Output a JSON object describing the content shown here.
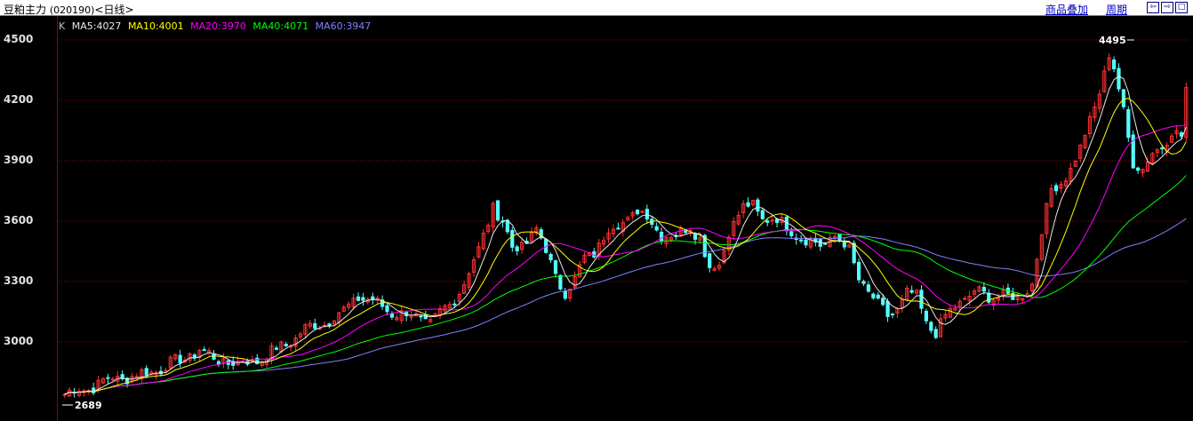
{
  "window": {
    "title_name": "豆粕主力",
    "title_code": "(020190)",
    "title_period": "<日线>",
    "overlay_label": "商品叠加",
    "cycle_label": "周期",
    "btn_prev_icon": "arrow-left-icon",
    "btn_next_icon": "arrow-right-icon",
    "btn_max_icon": "maximize-icon"
  },
  "legend": {
    "k": "K",
    "ma5": "MA5:4027",
    "ma10": "MA10:4001",
    "ma20": "MA20:3970",
    "ma40": "MA40:4071",
    "ma60": "MA60:3947"
  },
  "annotations": {
    "high": "4495",
    "low": "2689"
  },
  "colors": {
    "up": "#ff3232",
    "down": "#54ffff",
    "ma5": "#e8e8e8",
    "ma10": "#ffff00",
    "ma20": "#ff00ff",
    "ma40": "#00ff00",
    "ma60": "#8080ff",
    "grid": "#a00000"
  },
  "chart_data": {
    "type": "candlestick",
    "yticks": [
      "4500",
      "4200",
      "3900",
      "3600",
      "3300",
      "3000"
    ],
    "ylim": [
      2640,
      4560
    ],
    "grid": true,
    "high": 4495,
    "low": 2689,
    "close_path": [
      [
        0,
        2740
      ],
      [
        6,
        2780
      ],
      [
        10,
        2820
      ],
      [
        15,
        2830
      ],
      [
        20,
        2870
      ],
      [
        25,
        2920
      ],
      [
        28,
        2960
      ],
      [
        31,
        2920
      ],
      [
        36,
        2890
      ],
      [
        41,
        2920
      ],
      [
        46,
        2990
      ],
      [
        50,
        3060
      ],
      [
        54,
        3100
      ],
      [
        58,
        3150
      ],
      [
        61,
        3230
      ],
      [
        64,
        3200
      ],
      [
        68,
        3150
      ],
      [
        72,
        3130
      ],
      [
        76,
        3100
      ],
      [
        80,
        3180
      ],
      [
        83,
        3300
      ],
      [
        86,
        3450
      ],
      [
        88,
        3600
      ],
      [
        89,
        3680
      ],
      [
        91,
        3600
      ],
      [
        93,
        3460
      ],
      [
        95,
        3480
      ],
      [
        98,
        3560
      ],
      [
        100,
        3450
      ],
      [
        102,
        3330
      ],
      [
        104,
        3250
      ],
      [
        106,
        3300
      ],
      [
        108,
        3420
      ],
      [
        110,
        3450
      ],
      [
        113,
        3550
      ],
      [
        116,
        3600
      ],
      [
        119,
        3650
      ],
      [
        121,
        3620
      ],
      [
        124,
        3540
      ],
      [
        127,
        3520
      ],
      [
        130,
        3580
      ],
      [
        132,
        3520
      ],
      [
        134,
        3360
      ],
      [
        136,
        3380
      ],
      [
        138,
        3560
      ],
      [
        141,
        3660
      ],
      [
        143,
        3680
      ],
      [
        145,
        3620
      ],
      [
        148,
        3600
      ],
      [
        151,
        3560
      ],
      [
        154,
        3500
      ],
      [
        157,
        3480
      ],
      [
        160,
        3530
      ],
      [
        163,
        3450
      ],
      [
        165,
        3320
      ],
      [
        167,
        3250
      ],
      [
        169,
        3180
      ],
      [
        171,
        3130
      ],
      [
        173,
        3170
      ],
      [
        175,
        3240
      ],
      [
        177,
        3220
      ],
      [
        179,
        3100
      ],
      [
        181,
        3050
      ],
      [
        183,
        3120
      ],
      [
        186,
        3200
      ],
      [
        189,
        3250
      ],
      [
        192,
        3220
      ],
      [
        195,
        3240
      ],
      [
        198,
        3200
      ],
      [
        201,
        3300
      ],
      [
        203,
        3550
      ],
      [
        205,
        3750
      ],
      [
        207,
        3800
      ],
      [
        209,
        3860
      ],
      [
        211,
        3950
      ],
      [
        213,
        4100
      ],
      [
        215,
        4250
      ],
      [
        217,
        4420
      ],
      [
        218,
        4350
      ],
      [
        220,
        4150
      ],
      [
        222,
        3900
      ],
      [
        224,
        3850
      ],
      [
        226,
        3930
      ],
      [
        228,
        3980
      ],
      [
        230,
        4050
      ],
      [
        232,
        4010
      ],
      [
        233,
        4250
      ]
    ],
    "ma_values_last": {
      "MA5": 4027,
      "MA10": 4001,
      "MA20": 3970,
      "MA40": 4071,
      "MA60": 3947
    }
  }
}
